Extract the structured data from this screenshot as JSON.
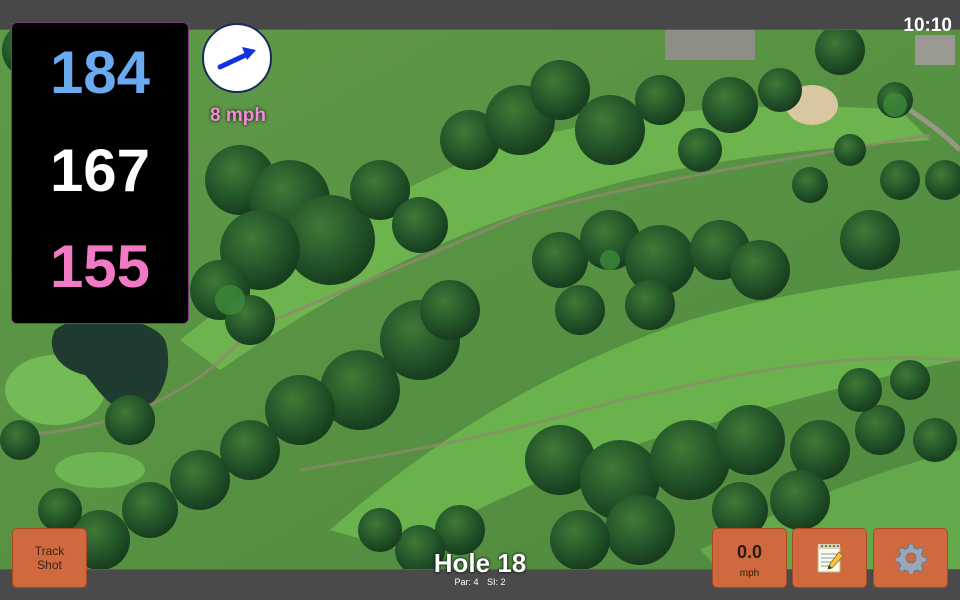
{
  "status_bar": {
    "time": "10:10"
  },
  "distances": {
    "back": "184",
    "center": "167",
    "front": "155"
  },
  "wind": {
    "speed": "8 mph",
    "direction_icon": "arrow-icon"
  },
  "track_shot": {
    "line1": "Track",
    "line2": "Shot"
  },
  "speed_display": {
    "value": "0.0",
    "unit": "mph"
  },
  "notes": {
    "icon": "notepad-icon"
  },
  "settings": {
    "icon": "gear-icon"
  },
  "hole": {
    "title": "Hole 18",
    "par": "Par: 4",
    "si": "SI: 2"
  },
  "colors": {
    "back_distance": "#6aaaf0",
    "center_distance": "#ffffff",
    "front_distance": "#f27ac4",
    "wind_text": "#f48ad8",
    "button": "#d06a3e",
    "divider": "#8a3a8a"
  }
}
